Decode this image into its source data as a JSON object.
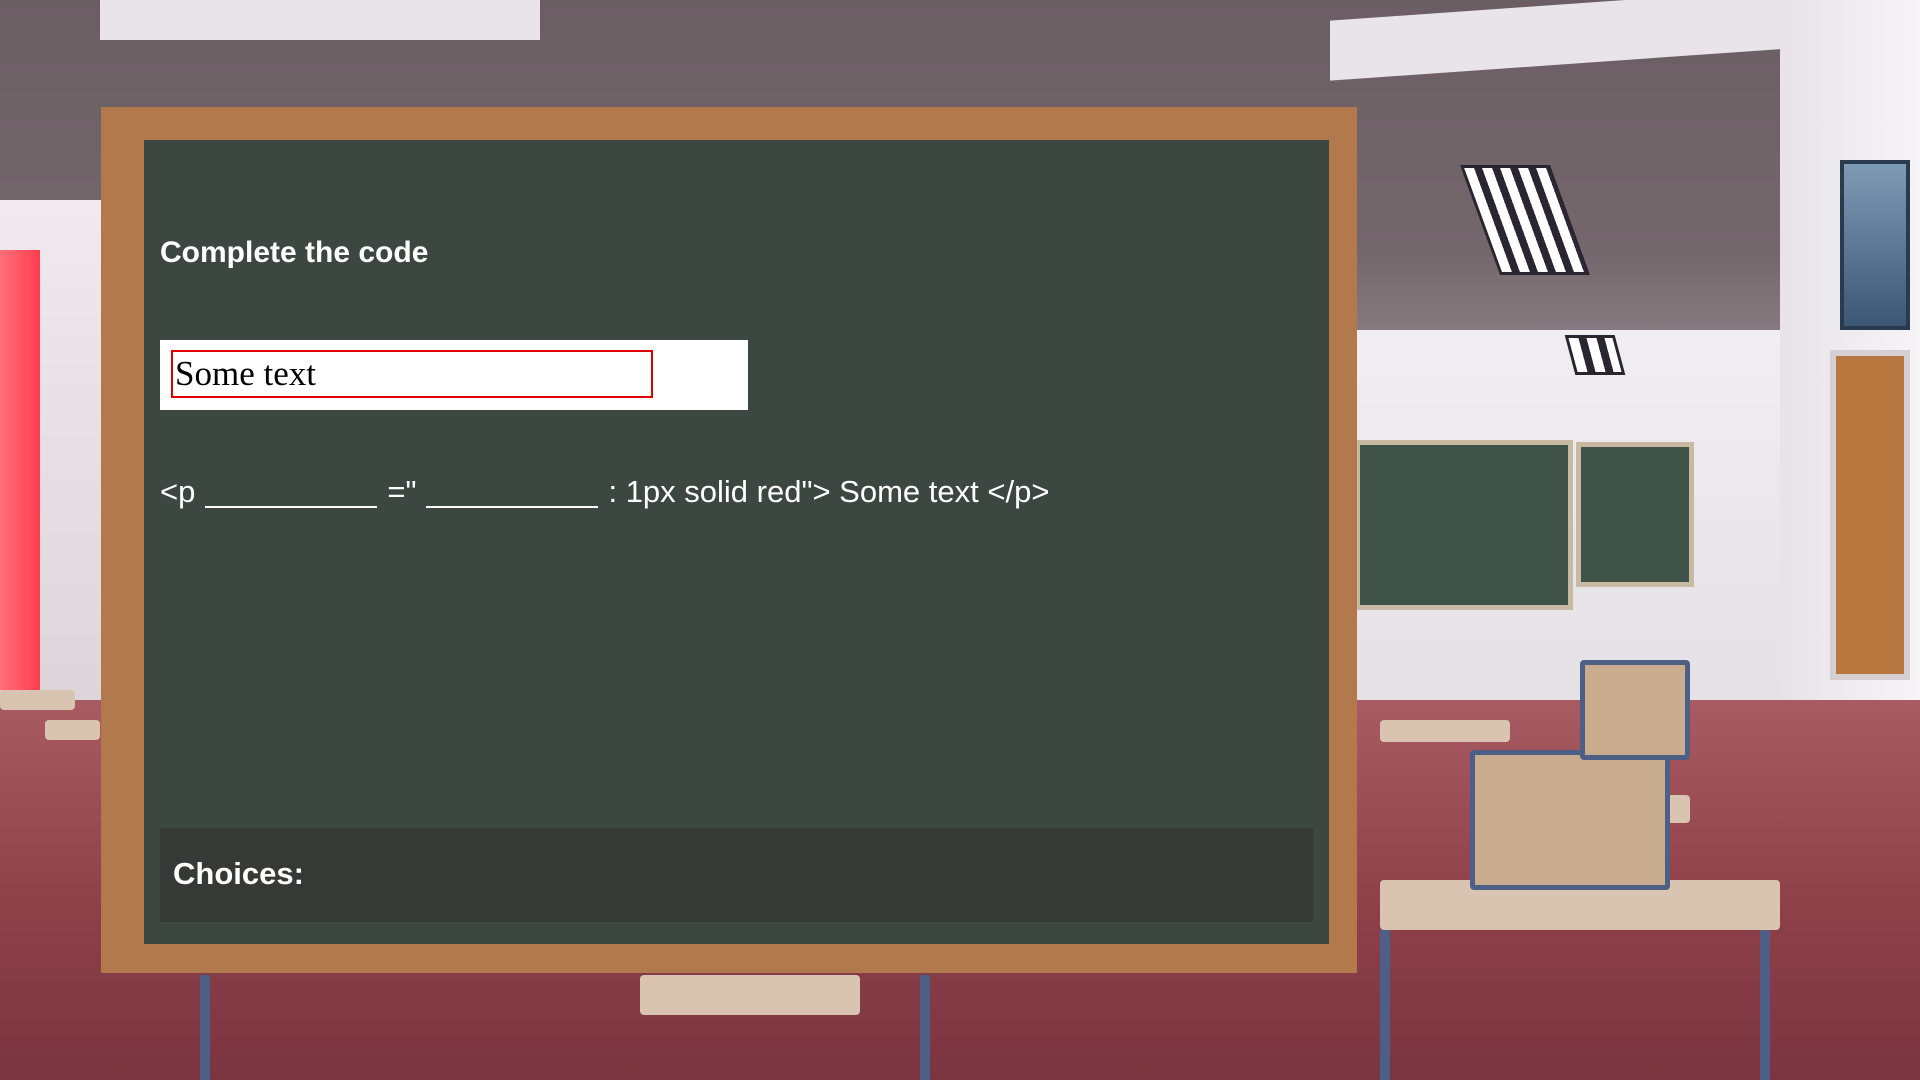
{
  "prompt": {
    "title": "Complete the code"
  },
  "preview": {
    "text": "Some text"
  },
  "code": {
    "open_tag": "<p",
    "equals_quote": "=\"",
    "rest": ": 1px solid red\"> Some text </p>"
  },
  "choices": {
    "label": "Choices:",
    "items": []
  },
  "colors": {
    "board": "#3c4741",
    "frame": "#b27a4c",
    "choices_panel": "#363a37",
    "preview_border": "#e00000"
  }
}
